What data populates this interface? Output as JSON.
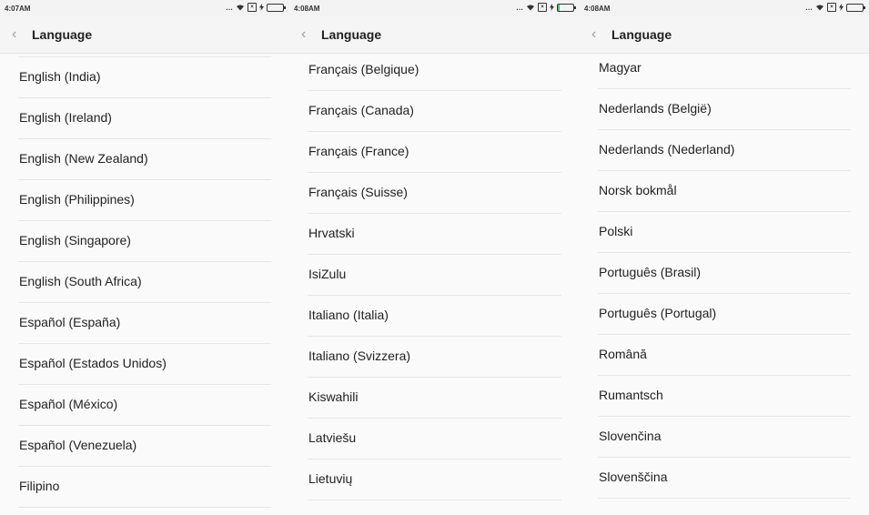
{
  "panels": [
    {
      "status_time": "4:07AM",
      "title": "Language",
      "items": [
        "English (India)",
        "English (Ireland)",
        "English (New Zealand)",
        "English (Philippines)",
        "English (Singapore)",
        "English (South Africa)",
        "Español (España)",
        "Español (Estados Unidos)",
        "Español (México)",
        "Español (Venezuela)",
        "Filipino"
      ]
    },
    {
      "status_time": "4:08AM",
      "title": "Language",
      "items": [
        "Français (Belgique)",
        "Français (Canada)",
        "Français (France)",
        "Français (Suisse)",
        "Hrvatski",
        "IsiZulu",
        "Italiano (Italia)",
        "Italiano (Svizzera)",
        "Kiswahili",
        "Latviešu",
        "Lietuvių"
      ]
    },
    {
      "status_time": "4:08AM",
      "title": "Language",
      "items": [
        "Magyar",
        "Nederlands (België)",
        "Nederlands (Nederland)",
        "Norsk bokmål",
        "Polski",
        "Português (Brasil)",
        "Português (Portugal)",
        "Română",
        "Rumantsch",
        "Slovenčina",
        "Slovenščina"
      ]
    }
  ],
  "icons": {
    "back": "chevron-left-icon",
    "signal_dots": "…",
    "wifi": "wifi-icon",
    "sim": "sim-icon",
    "charging": "lightning-icon",
    "battery": "battery-icon"
  },
  "colors": {
    "battery_accent": "#3cc36b",
    "divider": "#e6e6e6",
    "header_bg": "#f5f5f5"
  }
}
